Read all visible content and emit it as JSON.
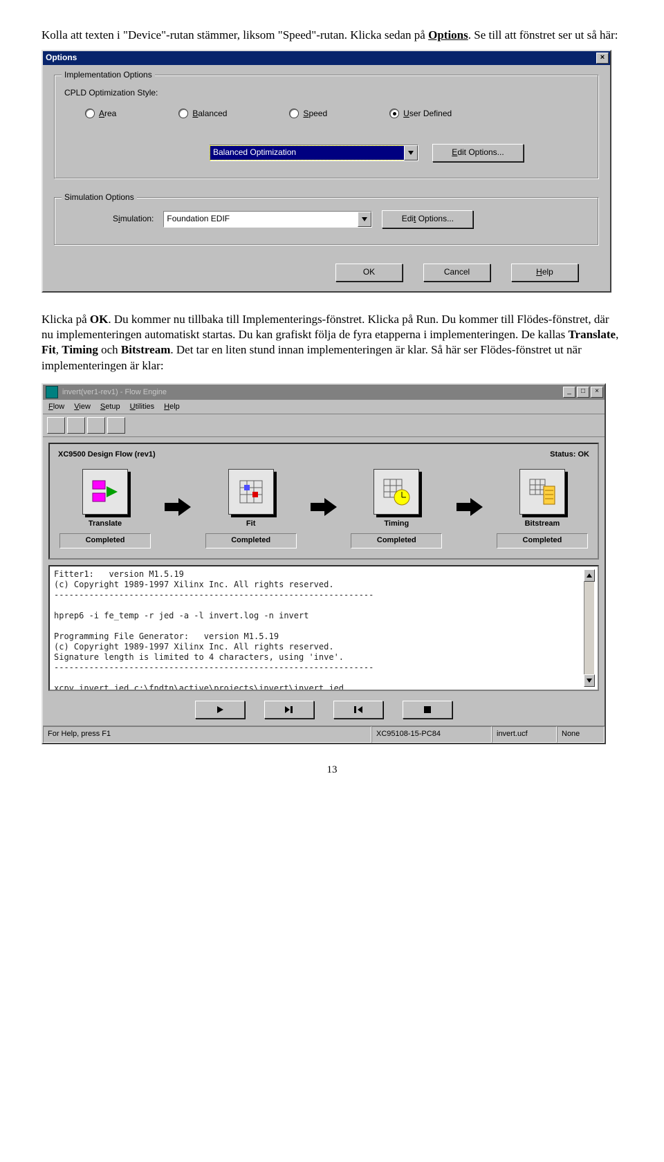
{
  "para1": {
    "pre": "Kolla att texten i \"Device\"-rutan stämmer, liksom \"Speed\"-rutan. Klicka sedan på ",
    "bold": "Options",
    "post": ". Se till att fönstret ser ut så här:"
  },
  "options_dialog": {
    "title": "Options",
    "group_impl": "Implementation Options",
    "cpld_label": "CPLD Optimization Style:",
    "radios": {
      "area": "Area",
      "balanced": "Balanced",
      "speed": "Speed",
      "user": "User Defined"
    },
    "combo_impl": "Balanced Optimization",
    "edit_options": "Edit Options...",
    "group_sim": "Simulation Options",
    "sim_label": "Simulation:",
    "combo_sim": "Foundation EDIF",
    "buttons": {
      "ok": "OK",
      "cancel": "Cancel",
      "help": "Help"
    }
  },
  "para2": {
    "a": "Klicka på ",
    "ok": "OK",
    "b": ". Du kommer nu tillbaka till Implementerings-fönstret. Klicka på Run. Du kommer till Flödes-fönstret, där nu implementeringen automatiskt startas. Du kan grafiskt följa de fyra etapperna i implementeringen. De kallas ",
    "t": "Translate",
    "c": ", ",
    "f": "Fit",
    "d": ", ",
    "ti": "Timing",
    "e": " och ",
    "bi": "Bitstream",
    "g": ". Det tar en liten stund innan implementeringen är klar. Så här ser Flödes-fönstret ut när implementeringen är klar:"
  },
  "flow_window": {
    "title": "invert(ver1-rev1) - Flow Engine",
    "menu": [
      "Flow",
      "View",
      "Setup",
      "Utilities",
      "Help"
    ],
    "header_left": "XC9500 Design Flow (rev1)",
    "header_right_label": "Status:",
    "header_right_value": "OK",
    "stages": [
      {
        "name": "Translate",
        "status": "Completed"
      },
      {
        "name": "Fit",
        "status": "Completed"
      },
      {
        "name": "Timing",
        "status": "Completed"
      },
      {
        "name": "Bitstream",
        "status": "Completed"
      }
    ],
    "log": "Fitter1:   version M1.5.19\n(c) Copyright 1989-1997 Xilinx Inc. All rights reserved.\n----------------------------------------------------------------\n\nhprep6 -i fe_temp -r jed -a -l invert.log -n invert\n\nProgramming File Generator:   version M1.5.19\n(c) Copyright 1989-1997 Xilinx Inc. All rights reserved.\nSignature length is limited to 4 characters, using 'inve'.\n----------------------------------------------------------------\n\nxcpy invert.jed c:\\fndtn\\active\\projects\\invert\\invert.jed",
    "statusbar": {
      "left": "For Help, press F1",
      "mid": "XC95108-15-PC84",
      "r1": "invert.ucf",
      "r2": "None"
    }
  },
  "page_number": "13"
}
